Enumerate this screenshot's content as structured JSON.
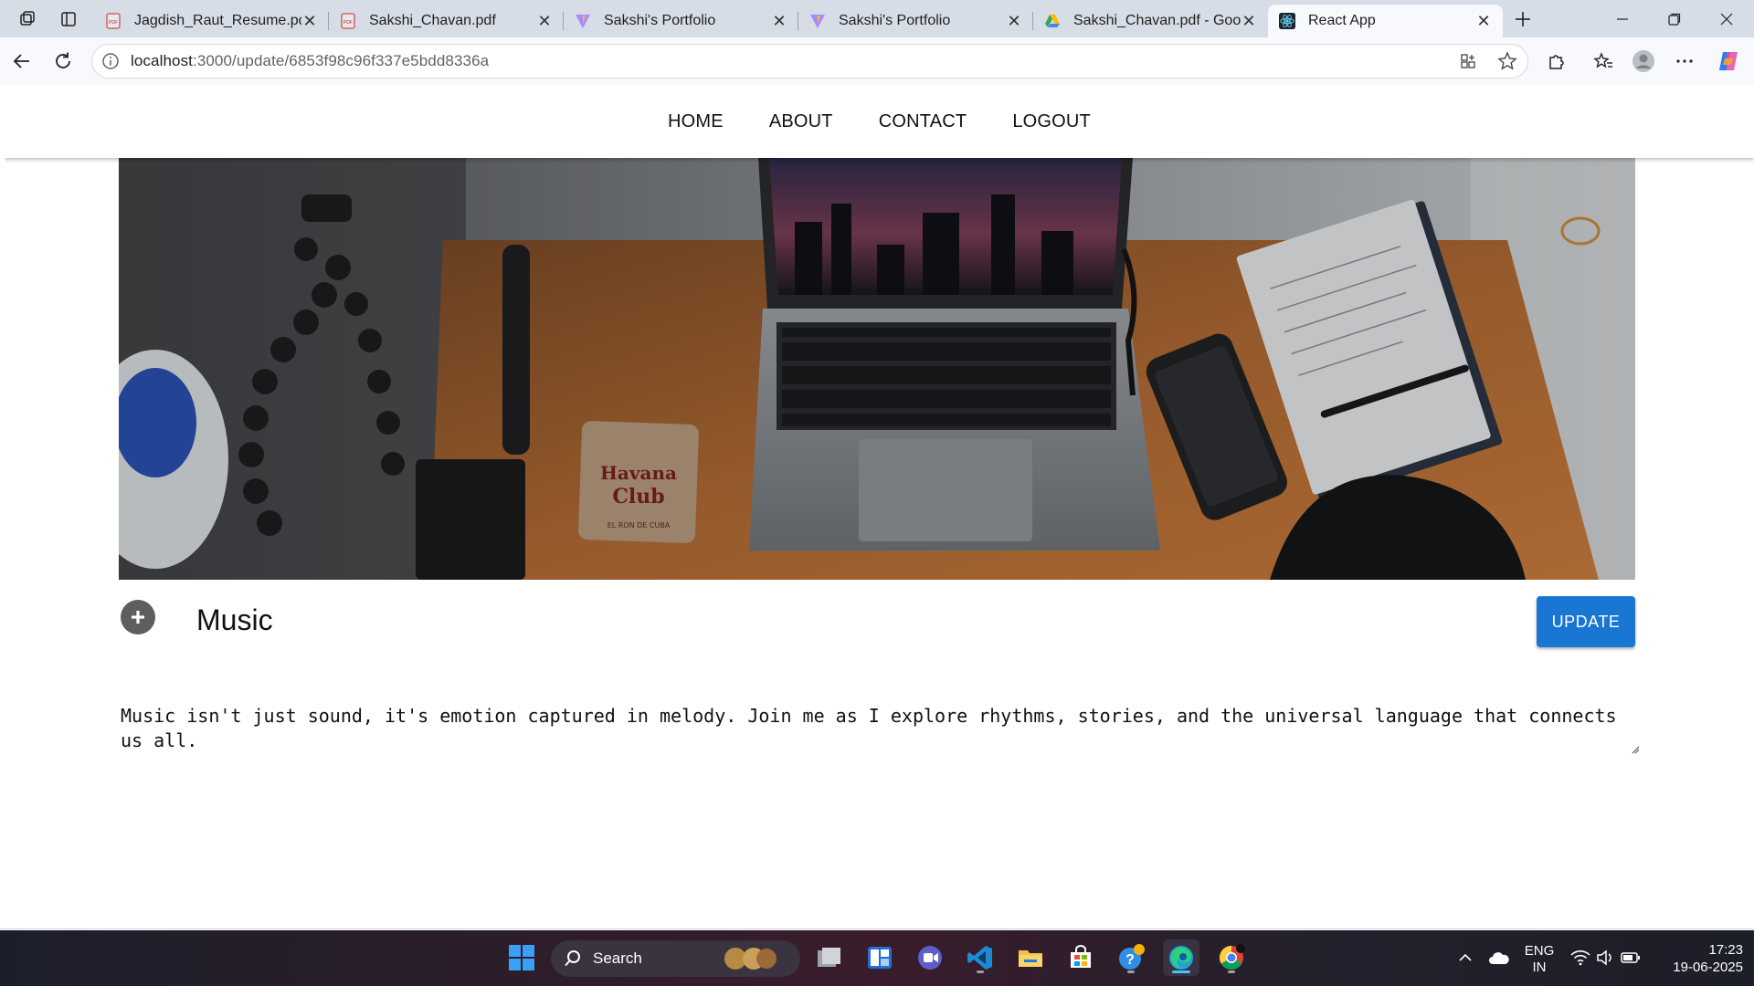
{
  "browser": {
    "tabs": [
      {
        "title": "Jagdish_Raut_Resume.pdf",
        "icon": "pdf-icon",
        "active": false
      },
      {
        "title": "Sakshi_Chavan.pdf",
        "icon": "pdf-icon",
        "active": false
      },
      {
        "title": "Sakshi's Portfolio",
        "icon": "vite-icon",
        "active": false
      },
      {
        "title": "Sakshi's Portfolio",
        "icon": "vite-icon",
        "active": false
      },
      {
        "title": "Sakshi_Chavan.pdf - Googl",
        "icon": "google-drive-icon",
        "active": false
      },
      {
        "title": "React App",
        "icon": "react-icon",
        "active": true
      }
    ],
    "url_host": "localhost",
    "url_rest": ":3000/update/6853f98c96f337e5bdd8336a"
  },
  "page": {
    "nav": [
      "HOME",
      "ABOUT",
      "CONTACT",
      "LOGOUT"
    ],
    "post": {
      "title": "Music",
      "update_label": "UPDATE",
      "description": "Music isn't just sound, it's emotion captured in melody. Join me as I explore rhythms, stories, and the universal language that connects us all."
    },
    "hero_image": {
      "coaster_line1": "Havana",
      "coaster_line2": "Club",
      "coaster_line3": "EL RON DE CUBA"
    }
  },
  "taskbar": {
    "search_label": "Search",
    "language_line1": "ENG",
    "language_line2": "IN",
    "time": "17:23",
    "date": "19-06-2025"
  },
  "colors": {
    "accent_button": "#1976d2",
    "tabstrip": "#d7dde6",
    "toolbar": "#f7f9fc"
  }
}
